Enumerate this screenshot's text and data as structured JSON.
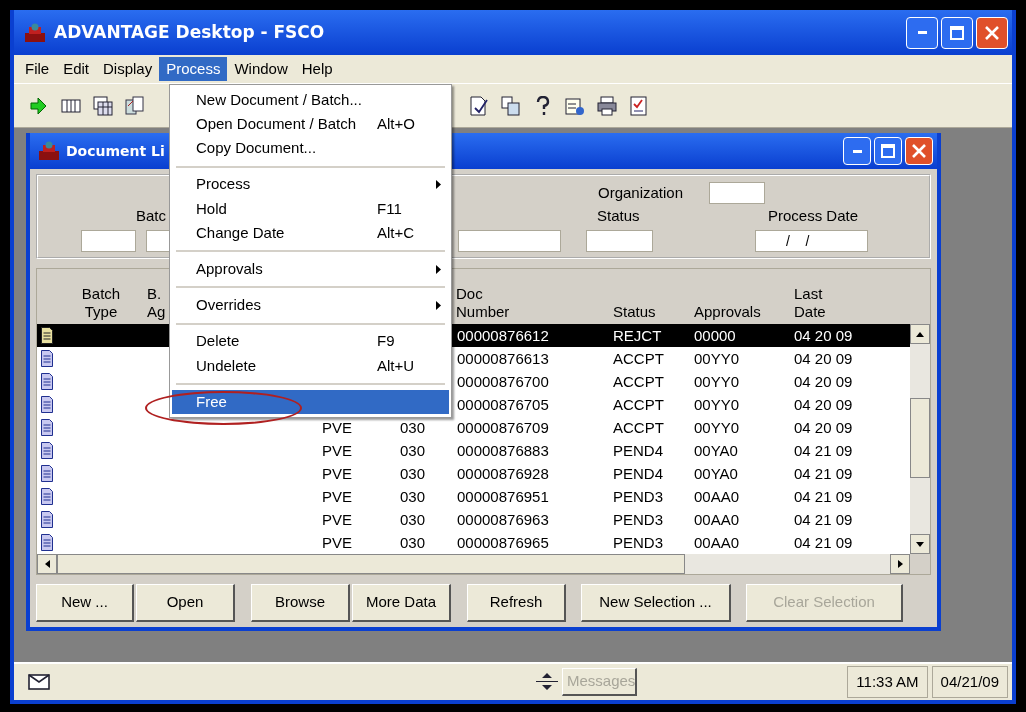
{
  "window": {
    "title": "ADVANTAGE Desktop - FSCO"
  },
  "menu_bar": [
    {
      "label": "File",
      "selected": false
    },
    {
      "label": "Edit",
      "selected": false
    },
    {
      "label": "Display",
      "selected": false
    },
    {
      "label": "Process",
      "selected": true
    },
    {
      "label": "Window",
      "selected": false
    },
    {
      "label": "Help",
      "selected": false
    }
  ],
  "process_menu": [
    {
      "kind": "item",
      "label": "New Document / Batch...",
      "submenu": false,
      "selected": false
    },
    {
      "kind": "item",
      "label": "Open Document / Batch",
      "shortcut": "Alt+O",
      "submenu": false,
      "selected": false
    },
    {
      "kind": "item",
      "label": "Copy Document...",
      "submenu": false,
      "selected": false
    },
    {
      "kind": "separator"
    },
    {
      "kind": "item",
      "label": "Process",
      "submenu": true,
      "selected": false
    },
    {
      "kind": "item",
      "label": "Hold",
      "shortcut": "F11",
      "submenu": false,
      "selected": false
    },
    {
      "kind": "item",
      "label": "Change Date",
      "shortcut": "Alt+C",
      "submenu": false,
      "selected": false
    },
    {
      "kind": "separator"
    },
    {
      "kind": "item",
      "label": "Approvals",
      "submenu": true,
      "selected": false
    },
    {
      "kind": "separator"
    },
    {
      "kind": "item",
      "label": "Overrides",
      "submenu": true,
      "selected": false
    },
    {
      "kind": "separator"
    },
    {
      "kind": "item",
      "label": "Delete",
      "shortcut": "F9",
      "submenu": false,
      "selected": false
    },
    {
      "kind": "item",
      "label": "Undelete",
      "shortcut": "Alt+U",
      "submenu": false,
      "selected": false
    },
    {
      "kind": "separator"
    },
    {
      "kind": "item",
      "label": "Free",
      "submenu": false,
      "selected": true,
      "circled": true
    }
  ],
  "document_window": {
    "title": "Document Li",
    "filters": {
      "batch_label": "Batc",
      "organization_label": "Organization",
      "status_label": "Status",
      "process_date_label": "Process Date",
      "process_date_value": "/    /"
    },
    "columns": {
      "batch_type": "Batch Type",
      "batch_agency": "B. Ag",
      "doc_number": "Doc Number",
      "status": "Status",
      "approvals": "Approvals",
      "last_date": "Last Date"
    },
    "rows": [
      {
        "selected": true,
        "doc_number": "00000876612",
        "status": "REJCT",
        "approvals": "00000",
        "last_date": "04 20 09"
      },
      {
        "selected": false,
        "doc_number": "00000876613",
        "status": "ACCPT",
        "approvals": "00YY0",
        "last_date": "04 20 09"
      },
      {
        "selected": false,
        "doc_number": "00000876700",
        "status": "ACCPT",
        "approvals": "00YY0",
        "last_date": "04 20 09"
      },
      {
        "selected": false,
        "doc_number": "00000876705",
        "status": "ACCPT",
        "approvals": "00YY0",
        "last_date": "04 20 09"
      },
      {
        "selected": false,
        "column_3": "PVE",
        "column_4": "030",
        "doc_number": "00000876709",
        "status": "ACCPT",
        "approvals": "00YY0",
        "last_date": "04 20 09"
      },
      {
        "selected": false,
        "column_3": "PVE",
        "column_4": "030",
        "doc_number": "00000876883",
        "status": "PEND4",
        "approvals": "00YA0",
        "last_date": "04 21 09"
      },
      {
        "selected": false,
        "column_3": "PVE",
        "column_4": "030",
        "doc_number": "00000876928",
        "status": "PEND4",
        "approvals": "00YA0",
        "last_date": "04 21 09"
      },
      {
        "selected": false,
        "column_3": "PVE",
        "column_4": "030",
        "doc_number": "00000876951",
        "status": "PEND3",
        "approvals": "00AA0",
        "last_date": "04 21 09"
      },
      {
        "selected": false,
        "column_3": "PVE",
        "column_4": "030",
        "doc_number": "00000876963",
        "status": "PEND3",
        "approvals": "00AA0",
        "last_date": "04 21 09"
      },
      {
        "selected": false,
        "column_3": "PVE",
        "column_4": "030",
        "doc_number": "00000876965",
        "status": "PEND3",
        "approvals": "00AA0",
        "last_date": "04 21 09"
      }
    ],
    "buttons": [
      {
        "label": "New ...",
        "disabled": false
      },
      {
        "label": "Open",
        "disabled": false
      },
      {
        "label": "Browse",
        "disabled": false
      },
      {
        "label": "More Data",
        "disabled": false
      },
      {
        "label": "Refresh",
        "disabled": false
      },
      {
        "label": "New Selection ...",
        "disabled": false
      },
      {
        "label": "Clear Selection",
        "disabled": true
      }
    ]
  },
  "status_bar": {
    "messages_button": {
      "label": "Messages",
      "disabled": true
    },
    "time": "11:33 AM",
    "date": "04/21/09"
  }
}
